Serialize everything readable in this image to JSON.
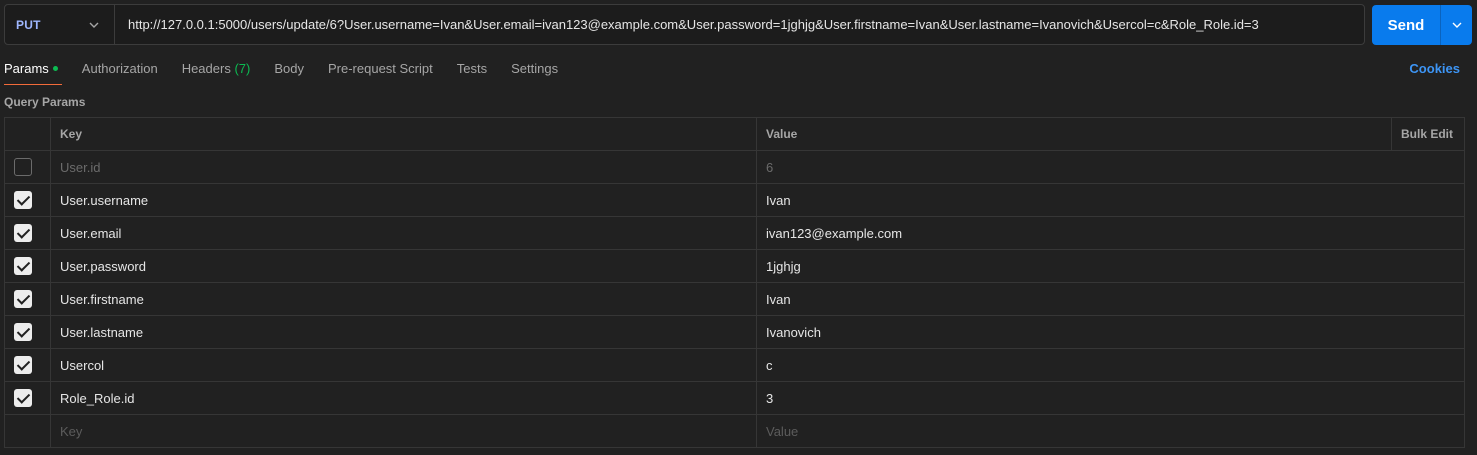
{
  "request": {
    "method": "PUT",
    "url": "http://127.0.0.1:5000/users/update/6?User.username=Ivan&User.email=ivan123@example.com&User.password=1jghjg&User.firstname=Ivan&User.lastname=Ivanovich&Usercol=c&Role_Role.id=3",
    "send_label": "Send"
  },
  "tabs": {
    "params": "Params",
    "authorization": "Authorization",
    "headers": "Headers",
    "headers_count": "(7)",
    "body": "Body",
    "prerequest": "Pre-request Script",
    "tests": "Tests",
    "settings": "Settings",
    "cookies": "Cookies"
  },
  "query_params": {
    "title": "Query Params",
    "col_key": "Key",
    "col_value": "Value",
    "bulk_edit": "Bulk Edit",
    "rows": [
      {
        "checked": false,
        "key": "User.id",
        "value": "6"
      },
      {
        "checked": true,
        "key": "User.username",
        "value": "Ivan"
      },
      {
        "checked": true,
        "key": "User.email",
        "value": "ivan123@example.com"
      },
      {
        "checked": true,
        "key": "User.password",
        "value": "1jghjg"
      },
      {
        "checked": true,
        "key": "User.firstname",
        "value": "Ivan"
      },
      {
        "checked": true,
        "key": "User.lastname",
        "value": "Ivanovich"
      },
      {
        "checked": true,
        "key": "Usercol",
        "value": "c"
      },
      {
        "checked": true,
        "key": "Role_Role.id",
        "value": "3"
      }
    ],
    "placeholder_key": "Key",
    "placeholder_value": "Value"
  },
  "colors": {
    "accent": "#097bed",
    "active_tab_underline": "#f26b3a",
    "status_green": "#0cbb52",
    "method_color": "#9fb7ff"
  }
}
